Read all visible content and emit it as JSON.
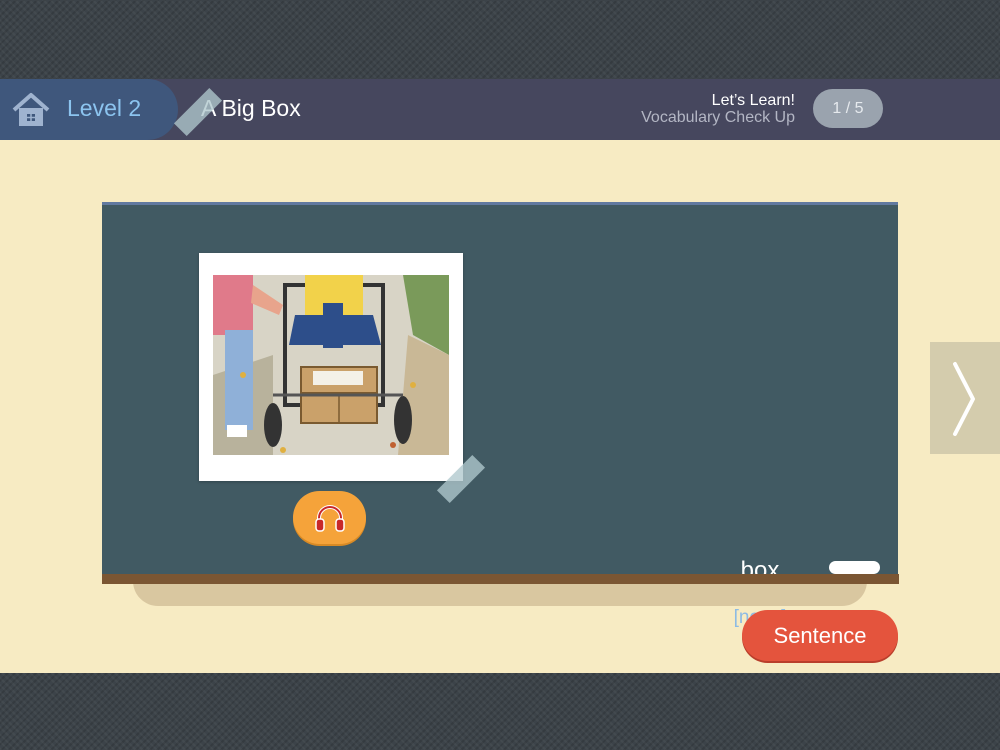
{
  "header": {
    "level_label": "Level 2",
    "book_title": "A Big Box",
    "activity_line1": "Let’s Learn!",
    "activity_line2": "Vocabulary Check Up",
    "progress": "1 / 5",
    "current_page": 1,
    "total_pages": 5
  },
  "card": {
    "word": "box",
    "part_of_speech": "[noun]",
    "image_icon": "stroller-box-illustration",
    "audio_icon": "headphones-icon"
  },
  "navigation": {
    "next_icon": "chevron-right-icon",
    "sentence_label": "Sentence"
  },
  "colors": {
    "header_bg": "#46475e",
    "level_pill_bg": "#3f577c",
    "board_bg": "#415a63",
    "content_bg": "#f7ebc3",
    "audio_button": "#f5a33a",
    "sentence_button": "#e4543d"
  }
}
